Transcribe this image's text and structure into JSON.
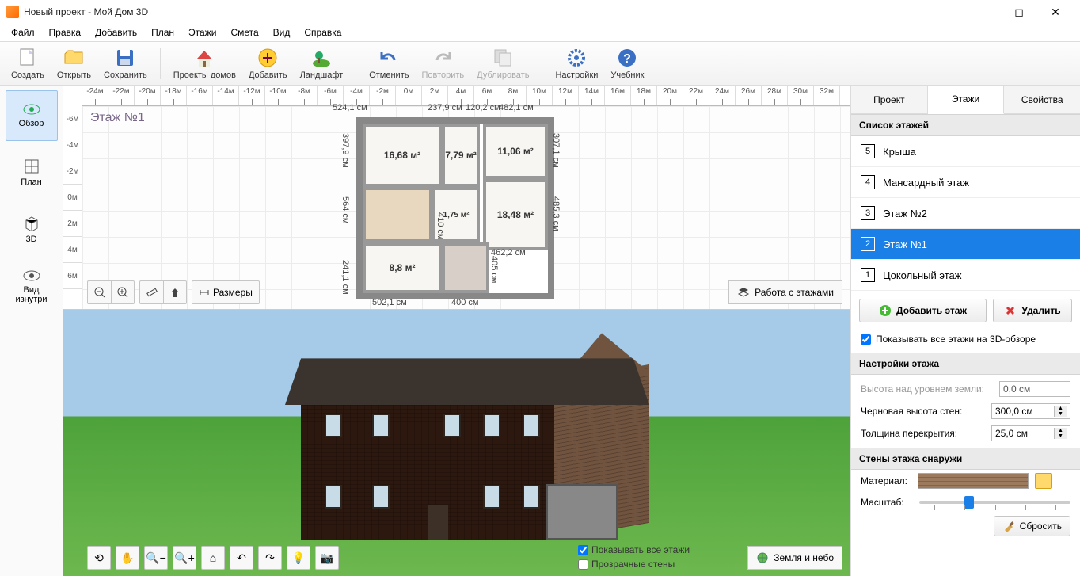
{
  "window": {
    "title": "Новый проект - Мой Дом 3D",
    "minimize": "—",
    "maximize": "◻",
    "close": "✕"
  },
  "menubar": [
    "Файл",
    "Правка",
    "Добавить",
    "План",
    "Этажи",
    "Смета",
    "Вид",
    "Справка"
  ],
  "toolbar": [
    {
      "id": "new",
      "label": "Создать"
    },
    {
      "id": "open",
      "label": "Открыть"
    },
    {
      "id": "save",
      "label": "Сохранить"
    },
    {
      "id": "sep"
    },
    {
      "id": "houses",
      "label": "Проекты домов"
    },
    {
      "id": "add",
      "label": "Добавить"
    },
    {
      "id": "landscape",
      "label": "Ландшафт"
    },
    {
      "id": "sep"
    },
    {
      "id": "undo",
      "label": "Отменить"
    },
    {
      "id": "redo",
      "label": "Повторить",
      "disabled": true
    },
    {
      "id": "duplicate",
      "label": "Дублировать",
      "disabled": true
    },
    {
      "id": "sep"
    },
    {
      "id": "settings",
      "label": "Настройки"
    },
    {
      "id": "help",
      "label": "Учебник"
    }
  ],
  "left_tools": [
    {
      "id": "overview",
      "label": "Обзор",
      "active": true
    },
    {
      "id": "plan",
      "label": "План"
    },
    {
      "id": "3d",
      "label": "3D"
    },
    {
      "id": "inside",
      "label": "Вид\nизнутри"
    }
  ],
  "ruler_h": [
    "-24м",
    "-22м",
    "-20м",
    "-18м",
    "-16м",
    "-14м",
    "-12м",
    "-10м",
    "-8м",
    "-6м",
    "-4м",
    "-2м",
    "0м",
    "2м",
    "4м",
    "6м",
    "8м",
    "10м",
    "12м",
    "14м",
    "16м",
    "18м",
    "20м",
    "22м",
    "24м",
    "26м",
    "28м",
    "30м",
    "32м"
  ],
  "ruler_v": [
    "-6м",
    "-4м",
    "-2м",
    "0м",
    "2м",
    "4м",
    "6м"
  ],
  "plan": {
    "floor_label": "Этаж №1",
    "dims": {
      "top1": "524,1 см",
      "top2": "237,9 см",
      "top3": "120,2 см",
      "top4": "482,1 см",
      "r1": "307,1 см",
      "r2": "485,3 см",
      "l1": "397,9 см",
      "l2": "564 см",
      "l3": "241,1 см",
      "b1": "502,1 см",
      "b2": "400 см",
      "bmid": "462,2 см",
      "mid_h": "410 см",
      "mid_h2": "405 см"
    },
    "rooms": {
      "a": "16,68 м²",
      "b": "7,79 м²",
      "c": "11,06 м²",
      "d": "18,48 м²",
      "e": "1,75 м²",
      "f": "8,8 м²"
    },
    "toolbar": {
      "sizes": "Размеры",
      "floors_work": "Работа с этажами"
    }
  },
  "view3d": {
    "show_all_floors": "Показывать все этажи",
    "transparent_walls": "Прозрачные стены",
    "sky_btn": "Земля и небо"
  },
  "right": {
    "tabs": {
      "project": "Проект",
      "floors": "Этажи",
      "props": "Свойства"
    },
    "list_header": "Список этажей",
    "floors": [
      {
        "num": "5",
        "label": "Крыша"
      },
      {
        "num": "4",
        "label": "Мансардный этаж"
      },
      {
        "num": "3",
        "label": "Этаж №2"
      },
      {
        "num": "2",
        "label": "Этаж №1",
        "selected": true
      },
      {
        "num": "1",
        "label": "Цокольный этаж"
      }
    ],
    "add_floor": "Добавить этаж",
    "delete": "Удалить",
    "show_all_3d": "Показывать все этажи на 3D-обзоре",
    "settings_header": "Настройки этажа",
    "height_above": "Высота над уровнем земли:",
    "height_above_val": "0,0 см",
    "wall_height": "Черновая высота стен:",
    "wall_height_val": "300,0 см",
    "slab": "Толщина перекрытия:",
    "slab_val": "25,0 см",
    "walls_header": "Стены этажа снаружи",
    "material": "Материал:",
    "scale": "Масштаб:",
    "reset": "Сбросить"
  }
}
